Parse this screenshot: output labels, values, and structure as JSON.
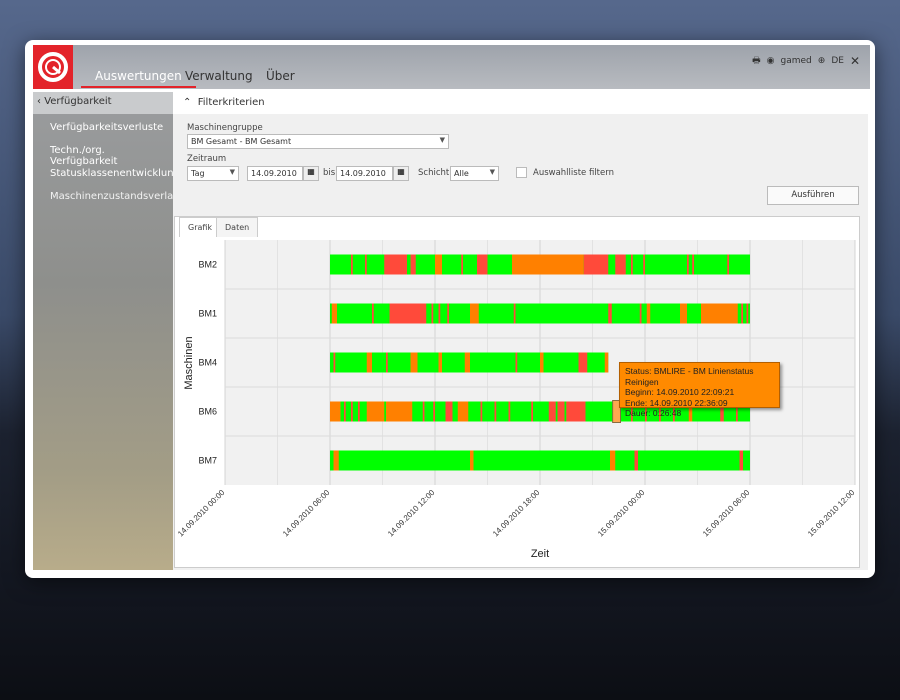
{
  "header": {
    "tabs": [
      "Auswertungen",
      "Verwaltung",
      "Über"
    ],
    "user": "gamed",
    "language": "DE"
  },
  "sidebar": {
    "back": "Verfügbarkeit",
    "items": [
      "Verfügbarkeitsverluste",
      "Techn./org. Verfügbarkeit",
      "Statusklassenentwicklung",
      "Maschinenzustandsverlauf"
    ]
  },
  "filter": {
    "title": "Filterkriterien",
    "group_label": "Maschinengruppe",
    "group_value": "BM Gesamt - BM Gesamt",
    "period_label": "Zeitraum",
    "period_value": "Tag",
    "from": "14.09.2010",
    "bis": "bis",
    "to": "14.09.2010",
    "shift_label": "Schicht",
    "shift_value": "Alle",
    "checkbox_label": "Auswahlliste filtern",
    "run": "Ausführen"
  },
  "tabs": [
    "Grafik",
    "Daten"
  ],
  "colors": {
    "run": "#00ff00",
    "stop": "#ff4a3a",
    "clean": "#ff8000"
  },
  "tooltip": [
    "Status: BMLIRE - BM Linienstatus Reinigen",
    "Beginn: 14.09.2010 22:09:21",
    "Ende: 14.09.2010 22:36:09",
    "Dauer: 0:26:48"
  ],
  "chart_data": {
    "type": "gantt",
    "xlabel": "Zeit",
    "ylabel": "Maschinen",
    "xticks": [
      "14.09.2010 00:00",
      "14.09.2010 06:00",
      "14.09.2010 12:00",
      "14.09.2010 18:00",
      "15.09.2010 00:00",
      "15.09.2010 06:00",
      "15.09.2010 12:00"
    ],
    "xrange_hours": [
      0,
      36
    ],
    "machines": [
      {
        "name": "BM2",
        "start": 6,
        "end": 30,
        "segments": [
          [
            7.2,
            7.3,
            "stop"
          ],
          [
            8,
            8.1,
            "stop"
          ],
          [
            9.1,
            10.4,
            "stop"
          ],
          [
            10.6,
            10.9,
            "stop"
          ],
          [
            12,
            12.4,
            "clean"
          ],
          [
            13.5,
            13.6,
            "stop"
          ],
          [
            14.4,
            15,
            "stop"
          ],
          [
            16.4,
            17,
            "clean"
          ],
          [
            17,
            20.5,
            "clean"
          ],
          [
            20.5,
            21.9,
            "stop"
          ],
          [
            22.3,
            22.9,
            "stop"
          ],
          [
            23.2,
            23.3,
            "stop"
          ],
          [
            23.9,
            24,
            "stop"
          ],
          [
            26.4,
            26.5,
            "stop"
          ],
          [
            26.7,
            26.8,
            "stop"
          ],
          [
            28.7,
            28.8,
            "stop"
          ]
        ]
      },
      {
        "name": "BM1",
        "start": 6,
        "end": 30,
        "segments": [
          [
            6.1,
            6.4,
            "clean"
          ],
          [
            8.4,
            8.5,
            "stop"
          ],
          [
            9.4,
            11.5,
            "stop"
          ],
          [
            11.8,
            11.9,
            "stop"
          ],
          [
            12.2,
            12.3,
            "stop"
          ],
          [
            12.7,
            12.8,
            "stop"
          ],
          [
            14,
            14.5,
            "clean"
          ],
          [
            16.5,
            16.6,
            "stop"
          ],
          [
            21.9,
            22.1,
            "stop"
          ],
          [
            23.7,
            23.8,
            "stop"
          ],
          [
            24.1,
            24.3,
            "clean"
          ],
          [
            26,
            26.4,
            "clean"
          ],
          [
            27.2,
            29.3,
            "clean"
          ],
          [
            29.5,
            29.6,
            "stop"
          ],
          [
            29.8,
            29.9,
            "stop"
          ]
        ]
      },
      {
        "name": "BM4",
        "start": 6,
        "end": 21.9,
        "segments": [
          [
            6.2,
            6.3,
            "stop"
          ],
          [
            8.1,
            8.4,
            "clean"
          ],
          [
            9.2,
            9.3,
            "stop"
          ],
          [
            10.6,
            11,
            "clean"
          ],
          [
            12.2,
            12.4,
            "clean"
          ],
          [
            13.7,
            14,
            "clean"
          ],
          [
            16.6,
            16.7,
            "stop"
          ],
          [
            18,
            18.2,
            "clean"
          ],
          [
            20.2,
            20.7,
            "stop"
          ],
          [
            21.7,
            21.9,
            "clean"
          ]
        ]
      },
      {
        "name": "BM6",
        "start": 6,
        "end": 30,
        "segments": [
          [
            6,
            6.6,
            "clean"
          ],
          [
            6.8,
            6.9,
            "stop"
          ],
          [
            7.2,
            7.3,
            "stop"
          ],
          [
            7.6,
            7.7,
            "stop"
          ],
          [
            8.1,
            9.1,
            "clean"
          ],
          [
            9.2,
            10.7,
            "clean"
          ],
          [
            11.3,
            11.4,
            "stop"
          ],
          [
            11.9,
            12,
            "stop"
          ],
          [
            12.6,
            13,
            "stop"
          ],
          [
            13.3,
            13.9,
            "clean"
          ],
          [
            14.6,
            14.7,
            "stop"
          ],
          [
            15.4,
            15.5,
            "stop"
          ],
          [
            16.2,
            16.3,
            "stop"
          ],
          [
            17.5,
            17.6,
            "stop"
          ],
          [
            18.5,
            18.9,
            "stop"
          ],
          [
            19,
            19.4,
            "stop"
          ],
          [
            19.5,
            20.6,
            "stop"
          ],
          [
            22.15,
            22.6,
            "clean"
          ],
          [
            23.2,
            23.3,
            "stop"
          ],
          [
            24,
            24.1,
            "stop"
          ],
          [
            24.8,
            24.9,
            "stop"
          ],
          [
            25.6,
            25.7,
            "stop"
          ],
          [
            26.5,
            26.7,
            "clean"
          ],
          [
            28.3,
            28.5,
            "stop"
          ],
          [
            29.2,
            29.3,
            "stop"
          ]
        ]
      },
      {
        "name": "BM7",
        "start": 6,
        "end": 30,
        "segments": [
          [
            6.2,
            6.5,
            "clean"
          ],
          [
            14,
            14.2,
            "clean"
          ],
          [
            22,
            22.3,
            "clean"
          ],
          [
            23.4,
            23.6,
            "stop"
          ],
          [
            29.4,
            29.6,
            "stop"
          ]
        ]
      }
    ]
  }
}
